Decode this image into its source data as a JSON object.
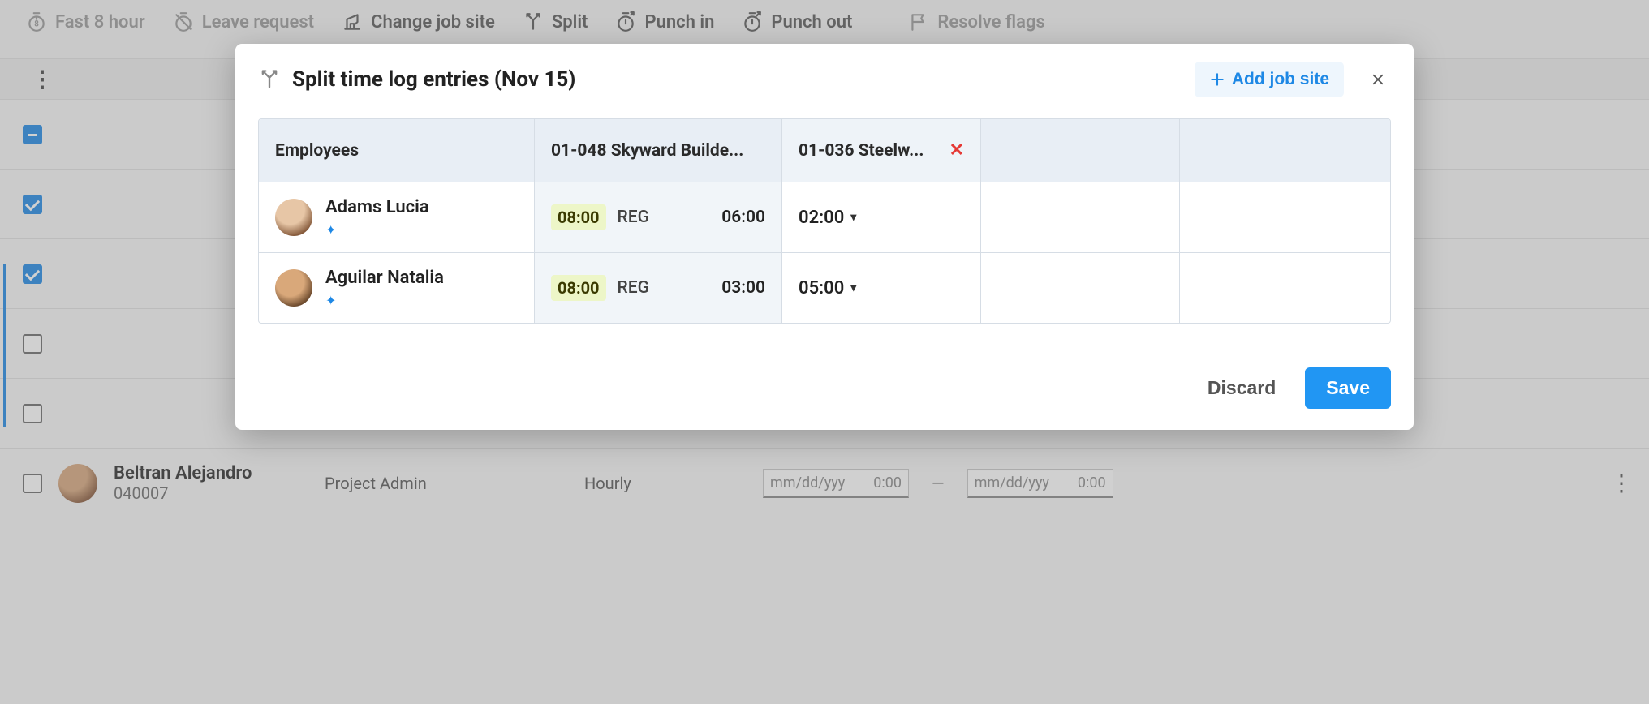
{
  "toolbar": {
    "fast8": "Fast 8 hour",
    "leave": "Leave request",
    "changeSite": "Change job site",
    "split": "Split",
    "punchIn": "Punch in",
    "punchOut": "Punch out",
    "resolveFlags": "Resolve flags"
  },
  "modal": {
    "title": "Split time log entries (Nov 15)",
    "addJobSite": "Add job site",
    "discard": "Discard",
    "save": "Save",
    "headers": {
      "employees": "Employees",
      "site1": "01-048 Skyward Builde...",
      "site2": "01-036 Steelw..."
    },
    "rows": [
      {
        "name": "Adams Lucia",
        "badge": "08:00",
        "type": "REG",
        "site1time": "06:00",
        "site2time": "02:00"
      },
      {
        "name": "Aguilar Natalia",
        "badge": "08:00",
        "type": "REG",
        "site1time": "03:00",
        "site2time": "05:00"
      }
    ]
  },
  "bgRow": {
    "name": "Beltran Alejandro",
    "id": "040007",
    "role": "Project Admin",
    "payType": "Hourly",
    "datePlaceholder": "mm/dd/yyy",
    "timePlaceholder": "0:00"
  }
}
